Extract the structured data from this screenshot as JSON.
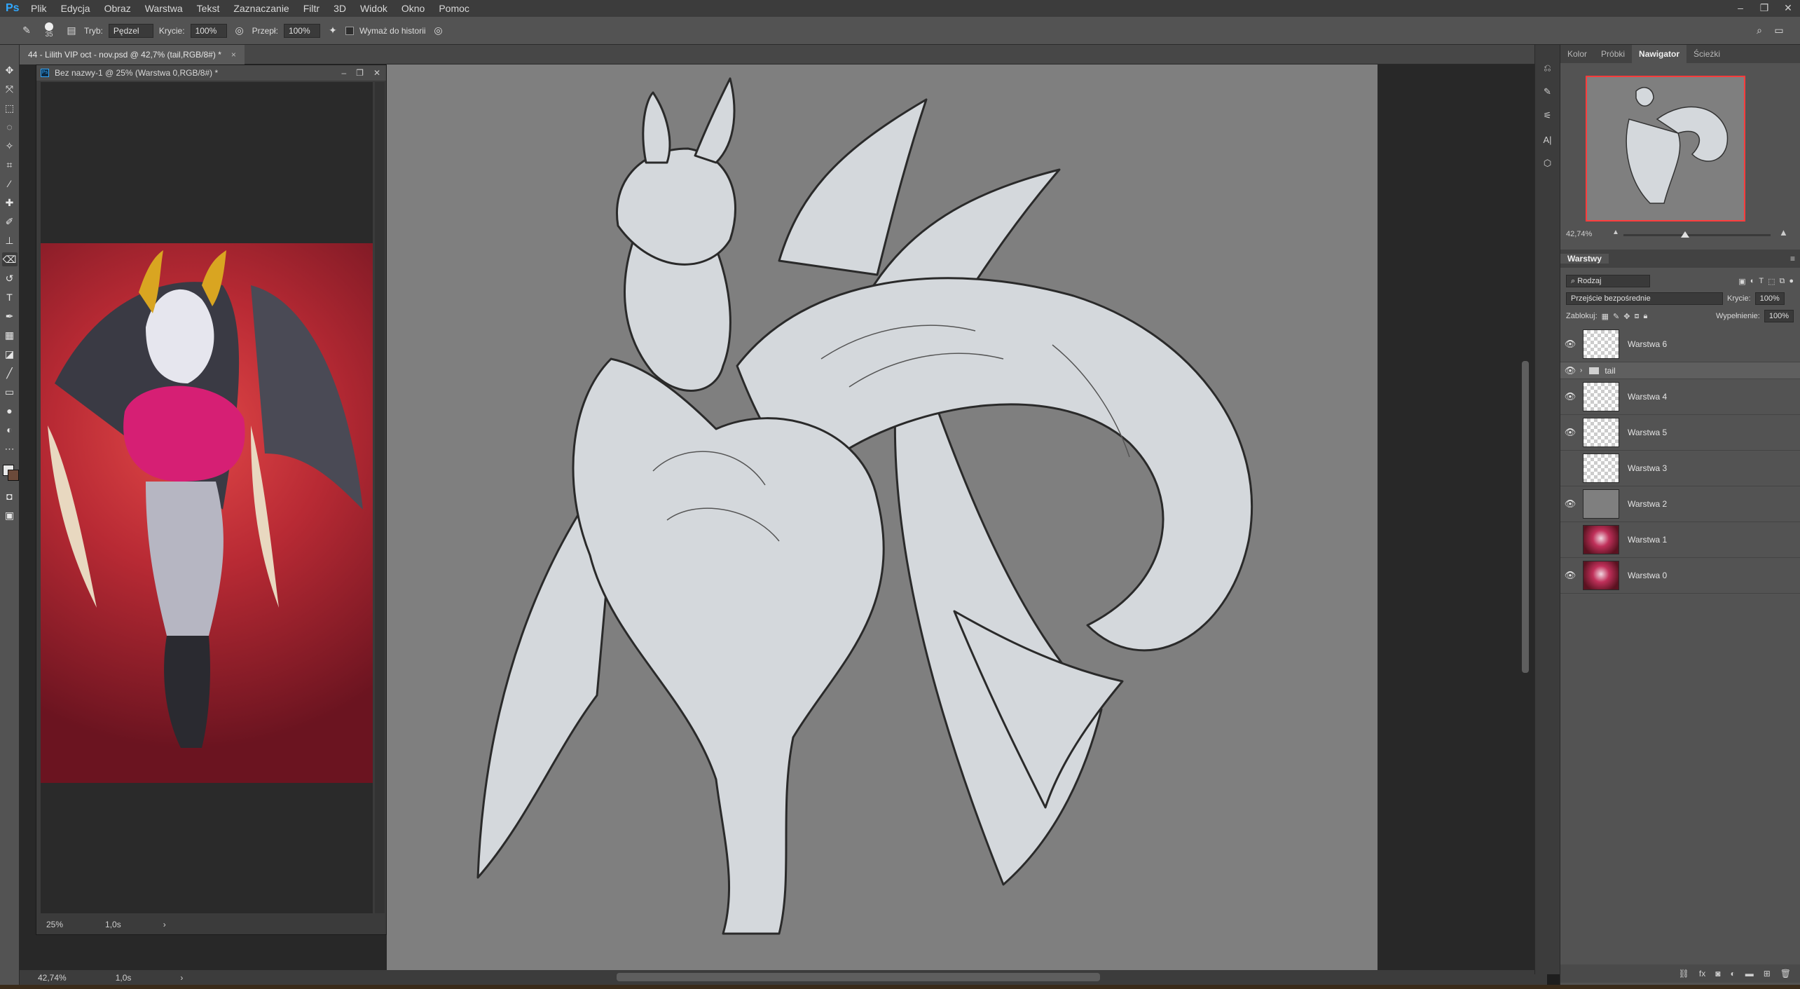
{
  "app": {
    "logo": "Ps"
  },
  "menu": [
    "Plik",
    "Edycja",
    "Obraz",
    "Warstwa",
    "Tekst",
    "Zaznaczanie",
    "Filtr",
    "3D",
    "Widok",
    "Okno",
    "Pomoc"
  ],
  "window_controls": {
    "minimize": "–",
    "restore": "❐",
    "close": "✕"
  },
  "options": {
    "brush_size": "35",
    "mode_label": "Tryb:",
    "mode_value": "Pędzel",
    "opacity_label": "Krycie:",
    "opacity_value": "100%",
    "flow_label": "Przepł:",
    "flow_value": "100%",
    "history_label": "Wymaż do historii"
  },
  "document": {
    "tab_title": "44 - Lilith VIP oct - nov.psd @ 42,7% (tail,RGB/8#) *",
    "zoom": "42,74%",
    "status_info": "1,0s"
  },
  "floating_doc": {
    "title": "Bez nazwy-1 @ 25% (Warstwa 0,RGB/8#) *",
    "zoom": "25%",
    "status_info": "1,0s"
  },
  "panel_tabs": [
    "Kolor",
    "Próbki",
    "Nawigator",
    "Ścieżki"
  ],
  "navigator": {
    "zoom": "42,74%"
  },
  "layers_panel": {
    "title": "Warstwy",
    "filter": "Rodzaj",
    "blend_mode": "Przejście bezpośrednie",
    "opacity_label": "Krycie:",
    "opacity_value": "100%",
    "lock_label": "Zablokuj:",
    "fill_label": "Wypełnienie:",
    "fill_value": "100%",
    "layers": [
      {
        "name": "Warstwa 6",
        "visible": true,
        "thumb": "transparent"
      },
      {
        "name": "tail",
        "visible": true,
        "thumb": "group"
      },
      {
        "name": "Warstwa 4",
        "visible": true,
        "thumb": "transparent"
      },
      {
        "name": "Warstwa 5",
        "visible": true,
        "thumb": "transparent"
      },
      {
        "name": "Warstwa 3",
        "visible": false,
        "thumb": "transparent"
      },
      {
        "name": "Warstwa 2",
        "visible": true,
        "thumb": "gray"
      },
      {
        "name": "Warstwa 1",
        "visible": false,
        "thumb": "art"
      },
      {
        "name": "Warstwa 0",
        "visible": true,
        "thumb": "art"
      }
    ]
  },
  "accent_color": "#31a8ff",
  "canvas_color": "#7f7f7f"
}
